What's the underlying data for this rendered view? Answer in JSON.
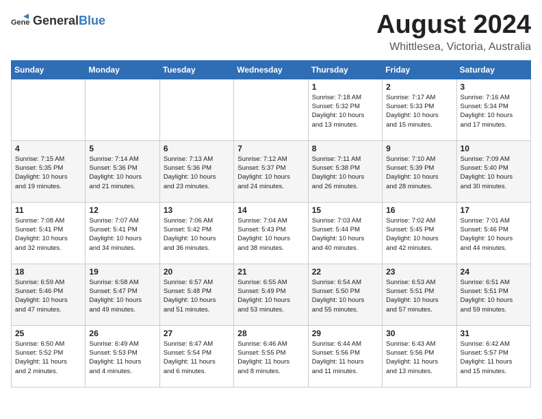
{
  "header": {
    "logo_general": "General",
    "logo_blue": "Blue",
    "month_year": "August 2024",
    "location": "Whittlesea, Victoria, Australia"
  },
  "days_of_week": [
    "Sunday",
    "Monday",
    "Tuesday",
    "Wednesday",
    "Thursday",
    "Friday",
    "Saturday"
  ],
  "weeks": [
    [
      {
        "day": "",
        "info": ""
      },
      {
        "day": "",
        "info": ""
      },
      {
        "day": "",
        "info": ""
      },
      {
        "day": "",
        "info": ""
      },
      {
        "day": "1",
        "info": "Sunrise: 7:18 AM\nSunset: 5:32 PM\nDaylight: 10 hours\nand 13 minutes."
      },
      {
        "day": "2",
        "info": "Sunrise: 7:17 AM\nSunset: 5:33 PM\nDaylight: 10 hours\nand 15 minutes."
      },
      {
        "day": "3",
        "info": "Sunrise: 7:16 AM\nSunset: 5:34 PM\nDaylight: 10 hours\nand 17 minutes."
      }
    ],
    [
      {
        "day": "4",
        "info": "Sunrise: 7:15 AM\nSunset: 5:35 PM\nDaylight: 10 hours\nand 19 minutes."
      },
      {
        "day": "5",
        "info": "Sunrise: 7:14 AM\nSunset: 5:36 PM\nDaylight: 10 hours\nand 21 minutes."
      },
      {
        "day": "6",
        "info": "Sunrise: 7:13 AM\nSunset: 5:36 PM\nDaylight: 10 hours\nand 23 minutes."
      },
      {
        "day": "7",
        "info": "Sunrise: 7:12 AM\nSunset: 5:37 PM\nDaylight: 10 hours\nand 24 minutes."
      },
      {
        "day": "8",
        "info": "Sunrise: 7:11 AM\nSunset: 5:38 PM\nDaylight: 10 hours\nand 26 minutes."
      },
      {
        "day": "9",
        "info": "Sunrise: 7:10 AM\nSunset: 5:39 PM\nDaylight: 10 hours\nand 28 minutes."
      },
      {
        "day": "10",
        "info": "Sunrise: 7:09 AM\nSunset: 5:40 PM\nDaylight: 10 hours\nand 30 minutes."
      }
    ],
    [
      {
        "day": "11",
        "info": "Sunrise: 7:08 AM\nSunset: 5:41 PM\nDaylight: 10 hours\nand 32 minutes."
      },
      {
        "day": "12",
        "info": "Sunrise: 7:07 AM\nSunset: 5:41 PM\nDaylight: 10 hours\nand 34 minutes."
      },
      {
        "day": "13",
        "info": "Sunrise: 7:06 AM\nSunset: 5:42 PM\nDaylight: 10 hours\nand 36 minutes."
      },
      {
        "day": "14",
        "info": "Sunrise: 7:04 AM\nSunset: 5:43 PM\nDaylight: 10 hours\nand 38 minutes."
      },
      {
        "day": "15",
        "info": "Sunrise: 7:03 AM\nSunset: 5:44 PM\nDaylight: 10 hours\nand 40 minutes."
      },
      {
        "day": "16",
        "info": "Sunrise: 7:02 AM\nSunset: 5:45 PM\nDaylight: 10 hours\nand 42 minutes."
      },
      {
        "day": "17",
        "info": "Sunrise: 7:01 AM\nSunset: 5:46 PM\nDaylight: 10 hours\nand 44 minutes."
      }
    ],
    [
      {
        "day": "18",
        "info": "Sunrise: 6:59 AM\nSunset: 5:46 PM\nDaylight: 10 hours\nand 47 minutes."
      },
      {
        "day": "19",
        "info": "Sunrise: 6:58 AM\nSunset: 5:47 PM\nDaylight: 10 hours\nand 49 minutes."
      },
      {
        "day": "20",
        "info": "Sunrise: 6:57 AM\nSunset: 5:48 PM\nDaylight: 10 hours\nand 51 minutes."
      },
      {
        "day": "21",
        "info": "Sunrise: 6:55 AM\nSunset: 5:49 PM\nDaylight: 10 hours\nand 53 minutes."
      },
      {
        "day": "22",
        "info": "Sunrise: 6:54 AM\nSunset: 5:50 PM\nDaylight: 10 hours\nand 55 minutes."
      },
      {
        "day": "23",
        "info": "Sunrise: 6:53 AM\nSunset: 5:51 PM\nDaylight: 10 hours\nand 57 minutes."
      },
      {
        "day": "24",
        "info": "Sunrise: 6:51 AM\nSunset: 5:51 PM\nDaylight: 10 hours\nand 59 minutes."
      }
    ],
    [
      {
        "day": "25",
        "info": "Sunrise: 6:50 AM\nSunset: 5:52 PM\nDaylight: 11 hours\nand 2 minutes."
      },
      {
        "day": "26",
        "info": "Sunrise: 6:49 AM\nSunset: 5:53 PM\nDaylight: 11 hours\nand 4 minutes."
      },
      {
        "day": "27",
        "info": "Sunrise: 6:47 AM\nSunset: 5:54 PM\nDaylight: 11 hours\nand 6 minutes."
      },
      {
        "day": "28",
        "info": "Sunrise: 6:46 AM\nSunset: 5:55 PM\nDaylight: 11 hours\nand 8 minutes."
      },
      {
        "day": "29",
        "info": "Sunrise: 6:44 AM\nSunset: 5:56 PM\nDaylight: 11 hours\nand 11 minutes."
      },
      {
        "day": "30",
        "info": "Sunrise: 6:43 AM\nSunset: 5:56 PM\nDaylight: 11 hours\nand 13 minutes."
      },
      {
        "day": "31",
        "info": "Sunrise: 6:42 AM\nSunset: 5:57 PM\nDaylight: 11 hours\nand 15 minutes."
      }
    ]
  ]
}
